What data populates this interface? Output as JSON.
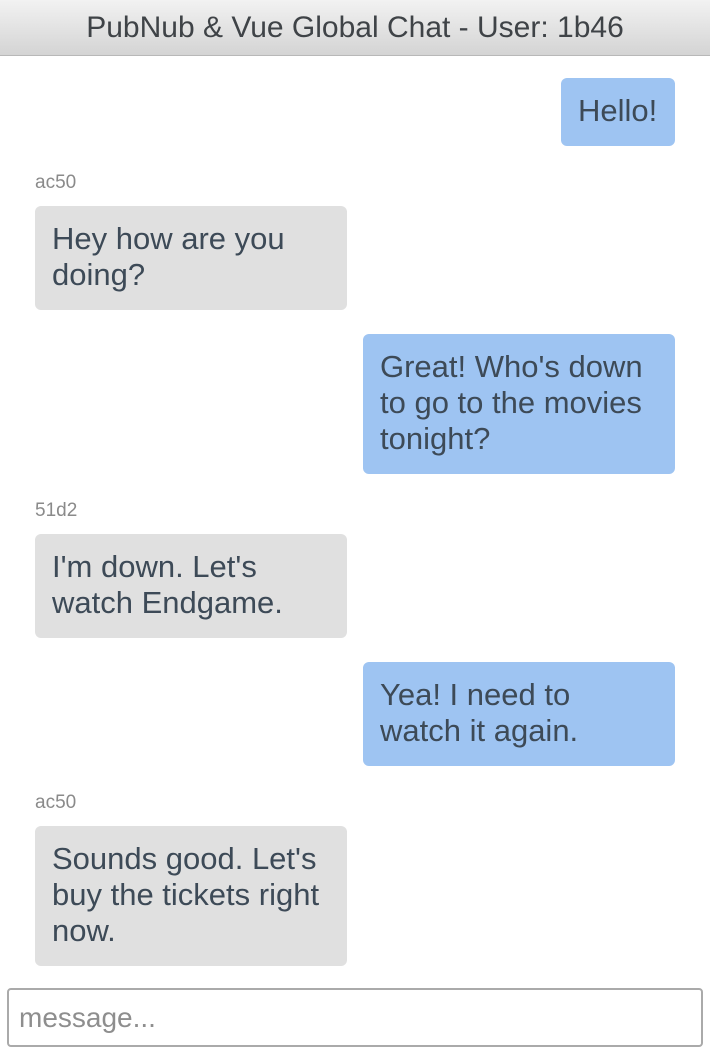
{
  "header": {
    "title": "PubNub & Vue Global Chat - User: 1b46"
  },
  "messages": [
    {
      "sender": "",
      "text": "Hello!",
      "self": true
    },
    {
      "sender": "ac50",
      "text": "Hey how are you doing?",
      "self": false
    },
    {
      "sender": "",
      "text": "Great! Who's down to go to the movies tonight?",
      "self": true
    },
    {
      "sender": "51d2",
      "text": "I'm down. Let's watch Endgame.",
      "self": false
    },
    {
      "sender": "",
      "text": "Yea! I need to watch it again.",
      "self": true
    },
    {
      "sender": "ac50",
      "text": "Sounds good. Let's buy the tickets right now.",
      "self": false
    }
  ],
  "composer": {
    "placeholder": "message...",
    "value": ""
  },
  "colors": {
    "self_bubble": "#9ec4f2",
    "other_bubble": "#e0e0e0",
    "header": "#d9d9d9"
  }
}
